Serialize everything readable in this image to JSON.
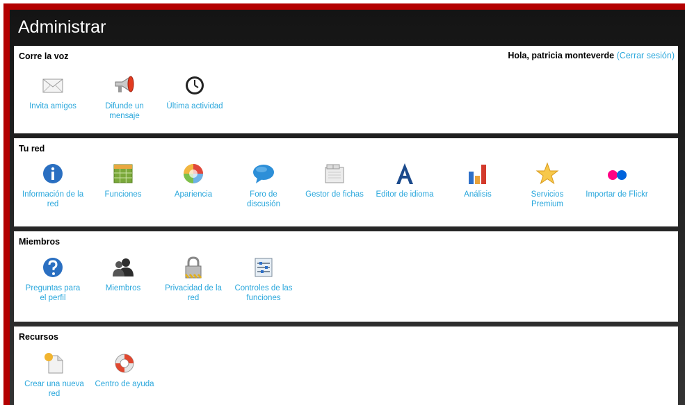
{
  "header": {
    "title": "Administrar"
  },
  "user": {
    "greeting": "Hola, patricia monteverde",
    "open_paren": "(",
    "logout": "Cerrar sesión",
    "close_paren": ")"
  },
  "sections": {
    "corre": {
      "title": "Corre la voz",
      "items": [
        {
          "label": "Invita amigos",
          "icon": "envelope-icon"
        },
        {
          "label": "Difunde un mensaje",
          "icon": "megaphone-icon"
        },
        {
          "label": "Última actividad",
          "icon": "clock-icon"
        }
      ]
    },
    "red": {
      "title": "Tu red",
      "items": [
        {
          "label": "Información de la red",
          "icon": "info-icon"
        },
        {
          "label": "Funciones",
          "icon": "grid-icon"
        },
        {
          "label": "Apariencia",
          "icon": "color-wheel-icon"
        },
        {
          "label": "Foro de discusión",
          "icon": "speech-bubble-icon"
        },
        {
          "label": "Gestor de fichas",
          "icon": "tabs-icon"
        },
        {
          "label": "Editor de idioma",
          "icon": "letter-a-icon"
        },
        {
          "label": "Análisis",
          "icon": "bar-chart-icon"
        },
        {
          "label": "Servicios Premium",
          "icon": "star-icon"
        },
        {
          "label": "Importar de Flickr",
          "icon": "flickr-icon"
        }
      ]
    },
    "miembros": {
      "title": "Miembros",
      "items": [
        {
          "label": "Preguntas para el perfil",
          "icon": "question-icon"
        },
        {
          "label": "Miembros",
          "icon": "members-icon"
        },
        {
          "label": "Privacidad de la red",
          "icon": "padlock-icon"
        },
        {
          "label": "Controles de las funciones",
          "icon": "sliders-icon"
        }
      ]
    },
    "recursos": {
      "title": "Recursos",
      "items": [
        {
          "label": "Crear una nueva red",
          "icon": "new-page-icon"
        },
        {
          "label": "Centro de ayuda",
          "icon": "lifebuoy-icon"
        }
      ]
    }
  }
}
